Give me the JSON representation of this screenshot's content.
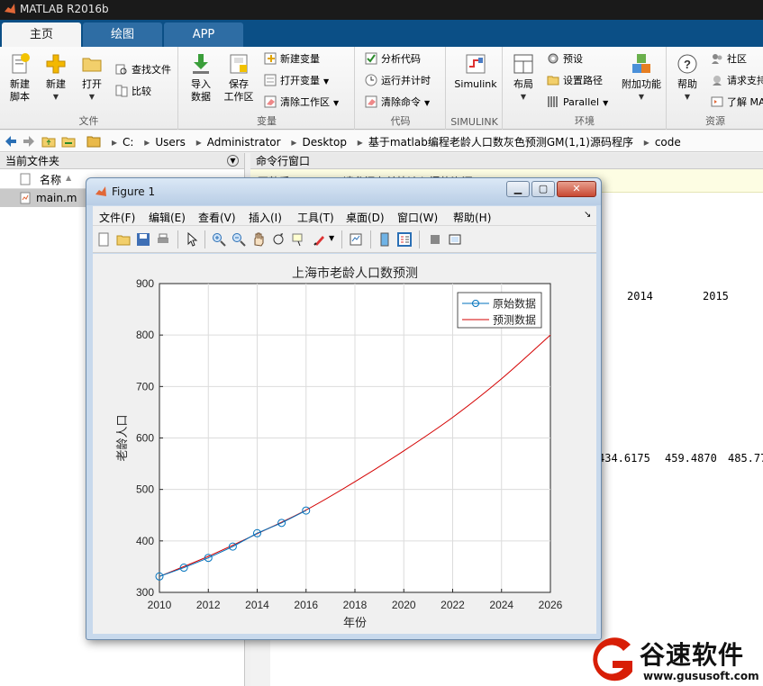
{
  "app": {
    "title": "MATLAB R2016b"
  },
  "tabs": [
    {
      "label": "主页",
      "active": true
    },
    {
      "label": "绘图",
      "active": false
    },
    {
      "label": "APP",
      "active": false
    }
  ],
  "ribbon": {
    "file": {
      "name": "文件",
      "new_script": "新建\n脚本",
      "new": "新建",
      "open": "打开",
      "find_files": "查找文件",
      "compare": "比较"
    },
    "variable": {
      "name": "变量",
      "import": "导入\n数据",
      "save_ws": "保存\n工作区",
      "new_var": "新建变量",
      "open_var": "打开变量",
      "clear_ws": "清除工作区"
    },
    "code": {
      "name": "代码",
      "analyze": "分析代码",
      "run_time": "运行并计时",
      "clear_cmd": "清除命令"
    },
    "simulink": {
      "name": "SIMULINK",
      "label": "Simulink"
    },
    "env": {
      "name": "环境",
      "layout": "布局",
      "prefs": "预设",
      "set_path": "设置路径",
      "parallel": "Parallel",
      "addons": "附加功能"
    },
    "resources": {
      "name": "资源",
      "help": "帮助",
      "community": "社区",
      "request": "请求支持",
      "learn": "了解 MA"
    }
  },
  "address": {
    "segments": [
      "C:",
      "Users",
      "Administrator",
      "Desktop",
      "基于matlab编程老龄人口数灰色预测GM(1,1)源码程序",
      "code"
    ]
  },
  "current_folder": {
    "title": "当前文件夹",
    "column_name": "名称",
    "files": [
      "main.m"
    ]
  },
  "command_window": {
    "title": "命令行窗口",
    "notice": "不熟悉 MATLAB?请参阅有关快速入门的资源。",
    "header_row": [
      "2014",
      "2015"
    ],
    "value_row": [
      "434.6175",
      "459.4870",
      "485.77"
    ]
  },
  "figure": {
    "title": "Figure 1",
    "menu": [
      "文件(F)",
      "编辑(E)",
      "查看(V)",
      "插入(I)",
      "工具(T)",
      "桌面(D)",
      "窗口(W)",
      "帮助(H)"
    ]
  },
  "colors": {
    "observed": "#0072bd",
    "predicted": "#d40000",
    "grid": "#dcdcdc",
    "tab_bar": "#0b4f86"
  },
  "chart_data": {
    "type": "line",
    "title": "上海市老龄人口数预测",
    "xlabel": "年份",
    "ylabel": "老龄人口",
    "xlim": [
      2010,
      2026
    ],
    "ylim": [
      300,
      900
    ],
    "xticks": [
      2010,
      2012,
      2014,
      2016,
      2018,
      2020,
      2022,
      2024,
      2026
    ],
    "yticks": [
      300,
      400,
      500,
      600,
      700,
      800,
      900
    ],
    "grid": true,
    "legend_position": "top-right",
    "series": [
      {
        "name": "原始数据",
        "style": "line-circle",
        "x": [
          2010,
          2011,
          2012,
          2013,
          2014,
          2015,
          2016
        ],
        "y": [
          331,
          348,
          367,
          389,
          415,
          435,
          459
        ]
      },
      {
        "name": "预测数据",
        "style": "line",
        "x": [
          2010,
          2012,
          2014,
          2016,
          2018,
          2020,
          2022,
          2024,
          2026
        ],
        "y": [
          331,
          370,
          414,
          460,
          515,
          575,
          640,
          715,
          800
        ]
      }
    ]
  },
  "watermark": {
    "brand": "谷速软件",
    "site": "www.gususoft.com"
  }
}
